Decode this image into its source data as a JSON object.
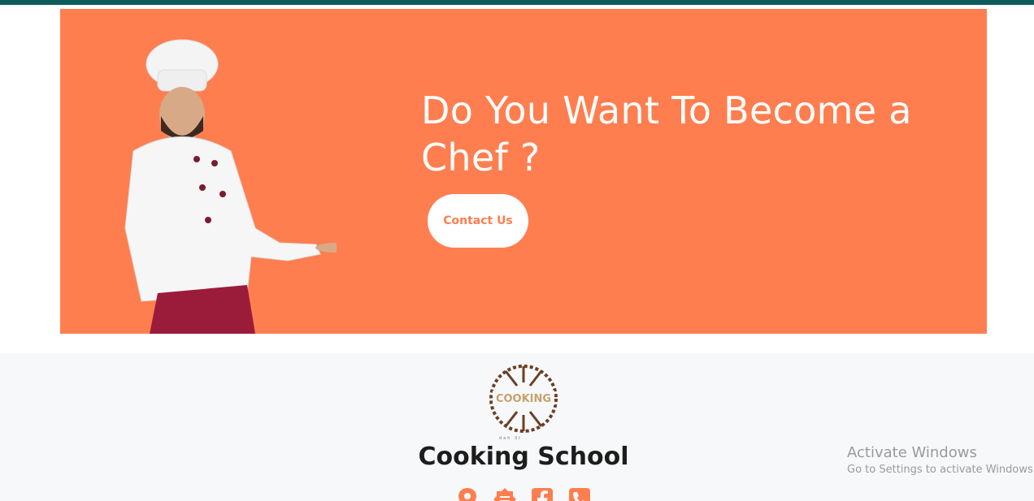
{
  "banner": {
    "headline": "Do You Want To Become a Chef ?",
    "cta_label": "Contact Us",
    "accent_color": "#ff7e4f"
  },
  "footer": {
    "logo_text": "COOKING",
    "logo_small_text": "dah      3t",
    "brand_name": "Cooking School",
    "social_icons": [
      "location-icon",
      "badge-icon",
      "facebook-icon",
      "phone-icon"
    ]
  },
  "os_watermark": {
    "title": "Activate Windows",
    "subtitle": "Go to Settings to activate Windows."
  },
  "colors": {
    "top_strip": "#0d5c5c",
    "footer_bg": "#f7f8fa"
  }
}
